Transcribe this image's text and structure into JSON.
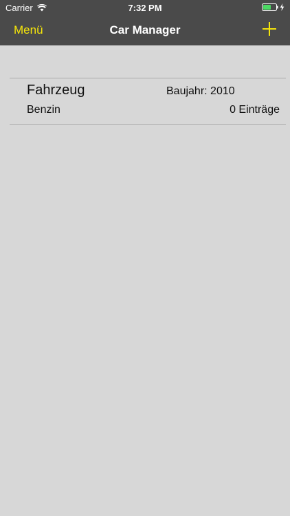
{
  "status_bar": {
    "carrier": "Carrier",
    "time": "7:32 PM",
    "battery_color": "#4cd964"
  },
  "nav": {
    "left_label": "Menü",
    "title": "Car Manager",
    "add_icon": "plus-icon",
    "accent_color": "#f5e50a"
  },
  "vehicles": [
    {
      "name": "Fahrzeug",
      "year_label": "Baujahr: 2010",
      "fuel": "Benzin",
      "entries": "0 Einträge"
    }
  ]
}
